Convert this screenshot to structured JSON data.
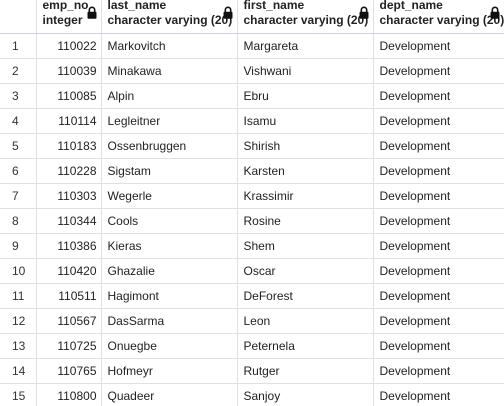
{
  "columns": [
    {
      "name": "emp_no",
      "type": "integer"
    },
    {
      "name": "last_name",
      "type": "character varying (20)"
    },
    {
      "name": "first_name",
      "type": "character varying (20)"
    },
    {
      "name": "dept_name",
      "type": "character varying (20)"
    }
  ],
  "rows": [
    {
      "num": "1",
      "emp_no": "110022",
      "last_name": "Markovitch",
      "first_name": "Margareta",
      "dept_name": "Development"
    },
    {
      "num": "2",
      "emp_no": "110039",
      "last_name": "Minakawa",
      "first_name": "Vishwani",
      "dept_name": "Development"
    },
    {
      "num": "3",
      "emp_no": "110085",
      "last_name": "Alpin",
      "first_name": "Ebru",
      "dept_name": "Development"
    },
    {
      "num": "4",
      "emp_no": "110114",
      "last_name": "Legleitner",
      "first_name": "Isamu",
      "dept_name": "Development"
    },
    {
      "num": "5",
      "emp_no": "110183",
      "last_name": "Ossenbruggen",
      "first_name": "Shirish",
      "dept_name": "Development"
    },
    {
      "num": "6",
      "emp_no": "110228",
      "last_name": "Sigstam",
      "first_name": "Karsten",
      "dept_name": "Development"
    },
    {
      "num": "7",
      "emp_no": "110303",
      "last_name": "Wegerle",
      "first_name": "Krassimir",
      "dept_name": "Development"
    },
    {
      "num": "8",
      "emp_no": "110344",
      "last_name": "Cools",
      "first_name": "Rosine",
      "dept_name": "Development"
    },
    {
      "num": "9",
      "emp_no": "110386",
      "last_name": "Kieras",
      "first_name": "Shem",
      "dept_name": "Development"
    },
    {
      "num": "10",
      "emp_no": "110420",
      "last_name": "Ghazalie",
      "first_name": "Oscar",
      "dept_name": "Development"
    },
    {
      "num": "11",
      "emp_no": "110511",
      "last_name": "Hagimont",
      "first_name": "DeForest",
      "dept_name": "Development"
    },
    {
      "num": "12",
      "emp_no": "110567",
      "last_name": "DasSarma",
      "first_name": "Leon",
      "dept_name": "Development"
    },
    {
      "num": "13",
      "emp_no": "110725",
      "last_name": "Onuegbe",
      "first_name": "Peternela",
      "dept_name": "Development"
    },
    {
      "num": "14",
      "emp_no": "110765",
      "last_name": "Hofmeyr",
      "first_name": "Rutger",
      "dept_name": "Development"
    },
    {
      "num": "15",
      "emp_no": "110800",
      "last_name": "Quadeer",
      "first_name": "Sanjoy",
      "dept_name": "Development"
    }
  ],
  "icons": {
    "locked_column": "lock-icon"
  },
  "colors": {
    "grid_line": "#dde0e5",
    "text": "#222222",
    "background": "#ffffff"
  }
}
